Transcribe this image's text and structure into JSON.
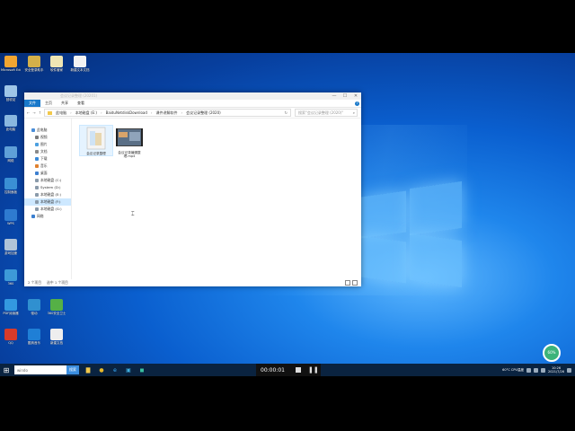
{
  "desktop": {
    "icons": [
      {
        "label": "Microsoft Edge",
        "color": "#f2a531"
      },
      {
        "label": "安全登录助手",
        "color": "#d4b04a"
      },
      {
        "label": "软件管家",
        "color": "#efe6b4"
      },
      {
        "label": "新建文本文档",
        "color": "#f3f3f3"
      },
      {
        "label": "回收站",
        "color": "#9fc6e8"
      },
      {
        "label": "此电脑",
        "color": "#8ab8e0"
      },
      {
        "label": "网络",
        "color": "#5fa0d8"
      },
      {
        "label": "控制面板",
        "color": "#3a8fd4"
      },
      {
        "label": "WPS",
        "color": "#2e7bd0"
      },
      {
        "label": "游戏加速",
        "color": "#b0c4d8"
      },
      {
        "label": "360",
        "color": "#3d9ad8"
      },
      {
        "label": "远程桌面",
        "color": "#4aa0e0"
      },
      {
        "label": "PDF阅读器",
        "color": "#3399e0"
      },
      {
        "label": "驱动",
        "color": "#3090d0"
      },
      {
        "label": "360安全卫士",
        "color": "#55b046"
      },
      {
        "label": "QQ",
        "color": "#d83b2a"
      },
      {
        "label": "酷狗音乐",
        "color": "#1f7fd6"
      },
      {
        "label": "新建文档",
        "color": "#eeeeee"
      }
    ]
  },
  "explorer": {
    "title": "会议记录整理 (20201)",
    "window_buttons": {
      "minimize": "—",
      "maximize": "☐",
      "close": "✕"
    },
    "ribbon": {
      "file": "文件",
      "tabs": [
        "主页",
        "共享",
        "查看"
      ],
      "help": "?"
    },
    "address": {
      "nav": [
        "←",
        "→",
        "↑"
      ],
      "path": [
        "此电脑",
        "本地磁盘 (E:)",
        "BaiduNetdiskDownload",
        "课件讲解软件",
        "会议记录整理 (2020)"
      ],
      "search_placeholder": "搜索\"会议记录整理 (2020)\"",
      "refresh": "↻",
      "search_icon": "⌕"
    },
    "nav_pane": [
      {
        "label": "此电脑",
        "color": "#4a8ed8"
      },
      {
        "label": "视频",
        "color": "#7a7a7a"
      },
      {
        "label": "图片",
        "color": "#4da0e0"
      },
      {
        "label": "文档",
        "color": "#8a8a8a"
      },
      {
        "label": "下载",
        "color": "#3a8ad8"
      },
      {
        "label": "音乐",
        "color": "#e0812f"
      },
      {
        "label": "桌面",
        "color": "#3d7fd0"
      },
      {
        "label": "本地磁盘 (C:)",
        "color": "#8a9aaa"
      },
      {
        "label": "System (D:)",
        "color": "#8a9aaa"
      },
      {
        "label": "本地磁盘 (E:)",
        "color": "#8a9aaa"
      },
      {
        "label": "本地磁盘 (F:)",
        "color": "#8a9aaa",
        "selected": true
      },
      {
        "label": "本地磁盘 (G:)",
        "color": "#8a9aaa"
      },
      {
        "label": "网络",
        "color": "#3a7fd0"
      }
    ],
    "files": [
      {
        "name": "会议记录整理",
        "kind": "document",
        "color": "#e9e9e9"
      },
      {
        "name": "会议记录编辑整理.mp4",
        "kind": "video",
        "color": "#4a4a4a"
      }
    ],
    "status": {
      "count": "2 个项目",
      "selected": "选中 1 个项目"
    }
  },
  "taskbar": {
    "start": "⊞",
    "search": "windo",
    "search_button": "搜索",
    "apps": [
      {
        "name": "file-explorer",
        "glyph": "▇",
        "color": "#f2c84b"
      },
      {
        "name": "chrome",
        "glyph": "●",
        "color": "#e8b82a"
      },
      {
        "name": "edge",
        "glyph": "e",
        "color": "#3ab0ff"
      },
      {
        "name": "store",
        "glyph": "▣",
        "color": "#40b0e0"
      },
      {
        "name": "app",
        "glyph": "◼",
        "color": "#3ac0a0"
      }
    ],
    "tray": {
      "weather": "60°C CPU温度",
      "time": "10:26",
      "date": "2021/7/26"
    }
  },
  "recording": {
    "time": "00:00:01",
    "pause": "❚❚"
  },
  "badge": {
    "text": "60%"
  },
  "colors": {
    "accent": "#1979ca",
    "selection": "#cde8ff"
  }
}
